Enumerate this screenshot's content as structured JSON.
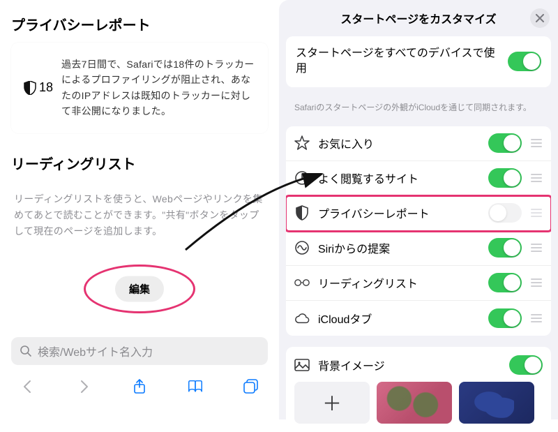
{
  "left": {
    "privacy": {
      "section_title": "プライバシーレポート",
      "count": "18",
      "text": "過去7日間で、Safariでは18件のトラッカーによるプロファイリングが阻止され、あなたのIPアドレスは既知のトラッカーに対して非公開になりました。"
    },
    "reading": {
      "section_title": "リーディングリスト",
      "hint": "リーディングリストを使うと、Webページやリンクを集めてあとで読むことができます。\"共有\"ボタンをタップして現在のページを追加します。",
      "edit_label": "編集"
    },
    "search_placeholder": "検索/Webサイト名入力"
  },
  "right": {
    "title": "スタートページをカスタマイズ",
    "sync": {
      "label": "スタートページをすべてのデバイスで使用",
      "footer": "Safariのスタートページの外観がiCloudを通じて同期されます。"
    },
    "items": [
      {
        "icon": "star",
        "label": "お気に入り",
        "on": true
      },
      {
        "icon": "clock",
        "label": "よく閲覧するサイト",
        "on": true
      },
      {
        "icon": "shield",
        "label": "プライバシーレポート",
        "on": false,
        "highlight": true
      },
      {
        "icon": "siri",
        "label": "Siriからの提案",
        "on": true
      },
      {
        "icon": "glasses",
        "label": "リーディングリスト",
        "on": true
      },
      {
        "icon": "cloud",
        "label": "iCloudタブ",
        "on": true
      }
    ],
    "bg": {
      "label": "背景イメージ",
      "on": true
    }
  }
}
